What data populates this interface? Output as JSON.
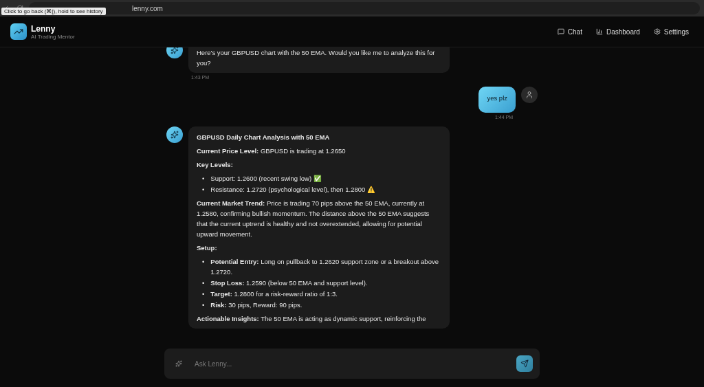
{
  "browser": {
    "url": "lenny.com",
    "tooltip": "Click to go back (⌘[), hold to see history"
  },
  "header": {
    "title": "Lenny",
    "subtitle": "AI Trading Mentor",
    "nav": [
      {
        "kind": "chat",
        "label": "Chat"
      },
      {
        "kind": "dashboard",
        "label": "Dashboard"
      },
      {
        "kind": "settings",
        "label": "Settings"
      }
    ]
  },
  "messages": [
    {
      "kind": "bot",
      "time": "1:43 PM",
      "blocks": [
        {
          "kind": "p",
          "text": "Here's your GBPUSD chart with the 50 EMA. Would you like me to analyze this for you?"
        }
      ]
    },
    {
      "kind": "user",
      "time": "1:44 PM",
      "blocks": [
        {
          "kind": "p",
          "text": "yes plz"
        }
      ]
    },
    {
      "kind": "bot",
      "blocks": [
        {
          "kind": "h",
          "text": "GBPUSD Daily Chart Analysis with 50 EMA"
        },
        {
          "kind": "p",
          "text": "**Current Price Level:** GBPUSD is trading at 1.2650"
        },
        {
          "kind": "h",
          "text": "Key Levels:"
        },
        {
          "kind": "ul",
          "marker": "•",
          "items": [
            "Support: 1.2600 (recent swing low) ✅",
            "Resistance: 1.2720 (psychological level), then 1.2800 ⚠️"
          ]
        },
        {
          "kind": "p",
          "text": "**Current Market Trend:** Price is trading 70 pips above the 50 EMA, currently at 1.2580, confirming bullish momentum. The distance above the 50 EMA suggests that the current uptrend is healthy and not overextended, allowing for potential upward movement."
        },
        {
          "kind": "h",
          "text": "Setup:"
        },
        {
          "kind": "ul",
          "marker": "•",
          "items": [
            "**Potential Entry:** Long on pullback to 1.2620 support zone or a breakout above 1.2720.",
            "**Stop Loss:** 1.2590 (below 50 EMA and support level).",
            "**Target:** 1.2800 for a risk-reward ratio of 1:3.",
            "**Risk:** 30 pips, Reward: 90 pips."
          ]
        },
        {
          "kind": "p",
          "text": "**Actionable Insights:** The 50 EMA is acting as dynamic support, reinforcing the"
        }
      ]
    }
  ],
  "input": {
    "placeholder": "Ask Lenny..."
  }
}
